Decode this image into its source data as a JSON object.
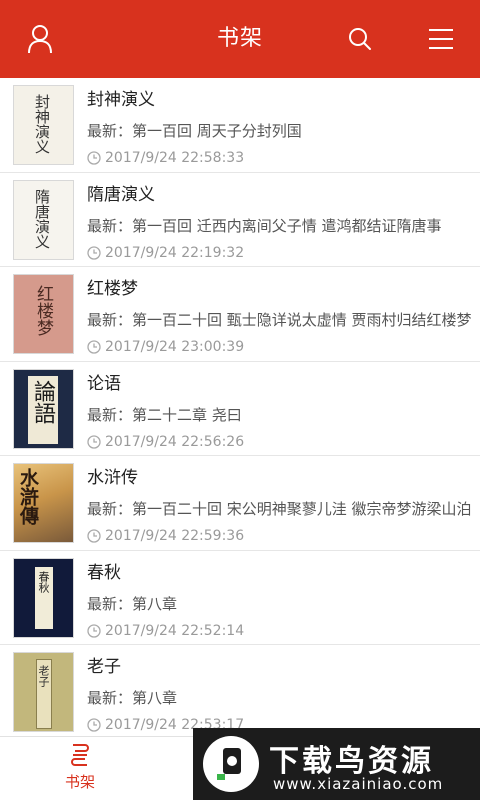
{
  "header": {
    "title": "书架",
    "icons": [
      "user-icon",
      "search-icon",
      "menu-icon"
    ],
    "color": "#d8321e"
  },
  "books": [
    {
      "title": "封神演义",
      "latest": "最新：第一百回 周天子分封列国",
      "time": "2017/9/24 22:58:33",
      "cover_text": "封神演义"
    },
    {
      "title": "隋唐演义",
      "latest": "最新：第一百回 迁西内离间父子情 遣鸿都结证隋唐事",
      "time": "2017/9/24 22:19:32",
      "cover_text": "隋唐演义"
    },
    {
      "title": "红楼梦",
      "latest": "最新：第一百二十回 甄士隐详说太虚情 贾雨村归结红楼梦",
      "time": "2017/9/24 23:00:39",
      "cover_text": "红楼梦"
    },
    {
      "title": "论语",
      "latest": "最新：第二十二章 尧曰",
      "time": "2017/9/24 22:56:26",
      "cover_text": "論語"
    },
    {
      "title": "水浒传",
      "latest": "最新：第一百二十回 宋公明神聚蓼儿洼 徽宗帝梦游梁山泊",
      "time": "2017/9/24 22:59:36",
      "cover_text": "水滸傳"
    },
    {
      "title": "春秋",
      "latest": "最新：第八章",
      "time": "2017/9/24 22:52:14",
      "cover_text": "春秋"
    },
    {
      "title": "老子",
      "latest": "最新：第八章",
      "time": "2017/9/24 22:53:17",
      "cover_text": "老子"
    }
  ],
  "bottom_nav": {
    "shelf_label": "书架",
    "active_color": "#d8321e"
  },
  "watermark": {
    "title": "下载鸟资源",
    "url": "www.xiazainiao.com"
  }
}
